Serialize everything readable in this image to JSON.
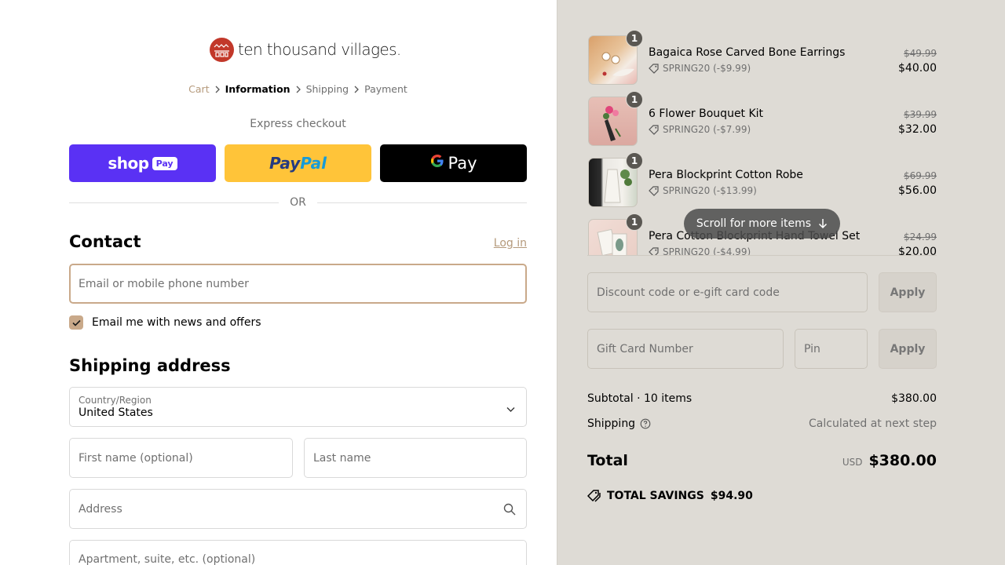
{
  "brand": {
    "name": "ten thousand villages."
  },
  "breadcrumb": [
    {
      "label": "Cart"
    },
    {
      "label": "Information"
    },
    {
      "label": "Shipping"
    },
    {
      "label": "Payment"
    }
  ],
  "express": {
    "title": "Express checkout",
    "shop_label": "shop",
    "shop_badge": "Pay",
    "paypal_pay": "Pay",
    "paypal_pal": "Pal",
    "gpay_label": "Pay",
    "or_label": "OR"
  },
  "contact": {
    "heading": "Contact",
    "login_label": "Log in",
    "email_placeholder": "Email or mobile phone number",
    "newsletter_label": "Email me with news and offers",
    "newsletter_checked": true
  },
  "shipping": {
    "heading": "Shipping address",
    "country_label": "Country/Region",
    "country_value": "United States",
    "first_name_placeholder": "First name (optional)",
    "last_name_placeholder": "Last name",
    "address_placeholder": "Address",
    "apartment_placeholder": "Apartment, suite, etc. (optional)"
  },
  "cart": {
    "items": [
      {
        "name": "Bagaica Rose Carved Bone Earrings",
        "qty": "1",
        "discount": "SPRING20 (-$9.99)",
        "original_price": "$49.99",
        "price": "$40.00"
      },
      {
        "name": "6 Flower Bouquet Kit",
        "qty": "1",
        "discount": "SPRING20 (-$7.99)",
        "original_price": "$39.99",
        "price": "$32.00"
      },
      {
        "name": "Pera Blockprint Cotton Robe",
        "qty": "1",
        "discount": "SPRING20 (-$13.99)",
        "original_price": "$69.99",
        "price": "$56.00"
      },
      {
        "name": "Pera Cotton Blockprint Hand Towel Set",
        "qty": "1",
        "discount": "SPRING20 (-$4.99)",
        "original_price": "$24.99",
        "price": "$20.00"
      }
    ],
    "scroll_hint": "Scroll for more items"
  },
  "discount": {
    "placeholder": "Discount code or e-gift card code",
    "apply_label": "Apply"
  },
  "gift_card": {
    "number_placeholder": "Gift Card Number",
    "pin_placeholder": "Pin",
    "apply_label": "Apply"
  },
  "summary": {
    "subtotal_label": "Subtotal · 10 items",
    "subtotal_value": "$380.00",
    "shipping_label": "Shipping",
    "shipping_value": "Calculated at next step",
    "total_label": "Total",
    "currency": "USD",
    "total_value": "$380.00",
    "savings_label": "TOTAL SAVINGS",
    "savings_value": "$94.90"
  },
  "colors": {
    "accent": "#c9a98a",
    "shop_purple": "#5a31f4",
    "paypal_yellow": "#ffc439",
    "sidebar_bg": "#dedbd5"
  }
}
